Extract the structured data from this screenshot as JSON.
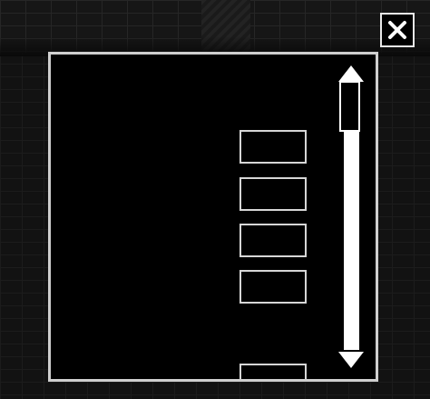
{
  "window": {
    "close_icon": "close-x-icon"
  },
  "inventory": {
    "slots": [
      {
        "label": ""
      },
      {
        "label": ""
      },
      {
        "label": ""
      },
      {
        "label": ""
      },
      {
        "label": ""
      }
    ]
  },
  "scrollbar": {
    "up_icon": "triangle-up-icon",
    "down_icon": "triangle-down-icon",
    "position": 0
  },
  "colors": {
    "panel_background": "#000000",
    "panel_border": "#cfcfcf",
    "slot_border": "#d6d6d6",
    "scrollbar": "#ffffff"
  }
}
